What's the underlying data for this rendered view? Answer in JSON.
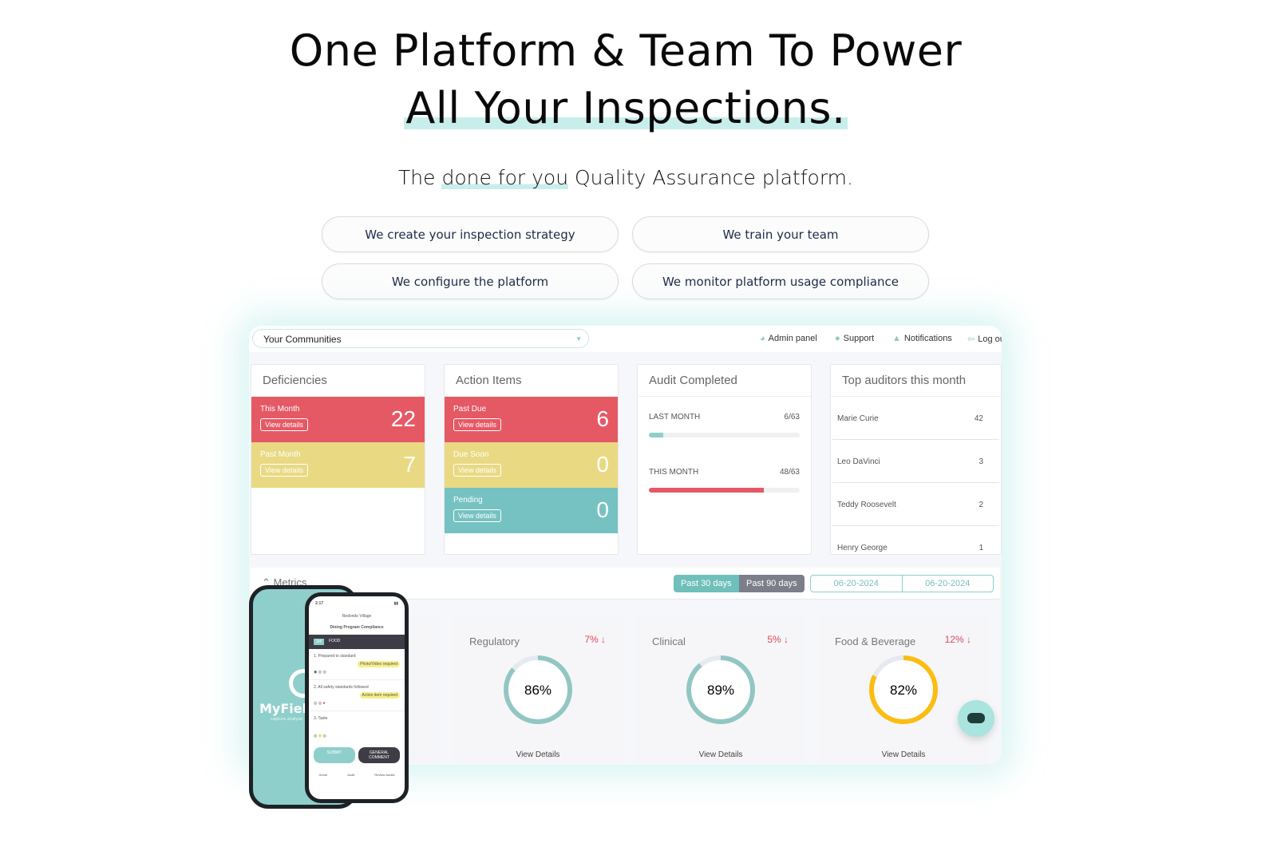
{
  "hero": {
    "title_line1": "One Platform & Team To Power",
    "title_line2": "All Your Inspections.",
    "subtitle_pre": "The ",
    "subtitle_highlight": "done for you",
    "subtitle_post": " Quality Assurance platform.",
    "highlight_color": "#c8eeec"
  },
  "pills": [
    "We create your inspection strategy",
    "We train your team",
    "We configure the platform",
    "We monitor platform usage compliance"
  ],
  "dashboard": {
    "community_select": "Your Communities",
    "nav": [
      {
        "label": "Admin panel",
        "icon": "dashboard-icon"
      },
      {
        "label": "Support",
        "icon": "user-icon"
      },
      {
        "label": "Notifications",
        "icon": "bell-icon"
      },
      {
        "label": "Log out",
        "icon": "logout-icon"
      }
    ],
    "deficiencies": {
      "title": "Deficiencies",
      "items": [
        {
          "label": "This Month",
          "button": "View details",
          "value": "22",
          "color": "#e55965"
        },
        {
          "label": "Past Month",
          "button": "View details",
          "value": "7",
          "color": "#e9d983"
        }
      ]
    },
    "action_items": {
      "title": "Action Items",
      "items": [
        {
          "label": "Past Due",
          "button": "View details",
          "value": "6",
          "color": "#e55965"
        },
        {
          "label": "Due Soon",
          "button": "View details",
          "value": "0",
          "color": "#e9d983"
        },
        {
          "label": "Pending",
          "button": "View details",
          "value": "0",
          "color": "#76c2c2"
        }
      ]
    },
    "audit": {
      "title": "Audit Completed",
      "rows": [
        {
          "label": "LAST MONTH",
          "value": "6/63",
          "fraction": 0.095,
          "color": "#8ccfcc"
        },
        {
          "label": "THIS MONTH",
          "value": "48/63",
          "fraction": 0.762,
          "color": "#e55965"
        }
      ]
    },
    "auditors": {
      "title": "Top auditors this month",
      "rows": [
        {
          "name": "Marie Curie",
          "count": "42"
        },
        {
          "name": "Leo DaVinci",
          "count": "3"
        },
        {
          "name": "Teddy Roosevelt",
          "count": "2"
        },
        {
          "name": "Henry George",
          "count": "1"
        }
      ]
    },
    "metrics": {
      "label": "Metrics",
      "range_active": "Past 30 days",
      "range_other": "Past 90 days",
      "date_from": "06-20-2024",
      "date_to": "06-20-2024",
      "cards": [
        {
          "title": "Regulatory",
          "delta": "7%",
          "value": "86%",
          "percent": 86,
          "color": "#92c6c3",
          "link": "View Details"
        },
        {
          "title": "Clinical",
          "delta": "5%",
          "value": "89%",
          "percent": 89,
          "color": "#92c6c3",
          "link": "View Details"
        },
        {
          "title": "Food & Beverage",
          "delta": "12%",
          "value": "82%",
          "percent": 82,
          "color": "#fbbd10",
          "link": "View Details"
        }
      ]
    }
  },
  "phone": {
    "brand": "MyField",
    "tagline": "capture analyze",
    "time": "2:17",
    "community": "Redondo Village",
    "program": "Dining Program Compliance",
    "section": "FOOD",
    "section_count": "3/4",
    "questions": [
      {
        "text": "1. Prepared to standard",
        "tag": "Photo/Video required"
      },
      {
        "text": "2. All safety standards followed",
        "tag": "Action item required"
      },
      {
        "text": "3. Taste",
        "tag": ""
      }
    ],
    "submit": "SUBMIT",
    "comment": "GENERAL COMMENT",
    "tabs": [
      "Home",
      "Audit",
      "Review Audits"
    ]
  }
}
